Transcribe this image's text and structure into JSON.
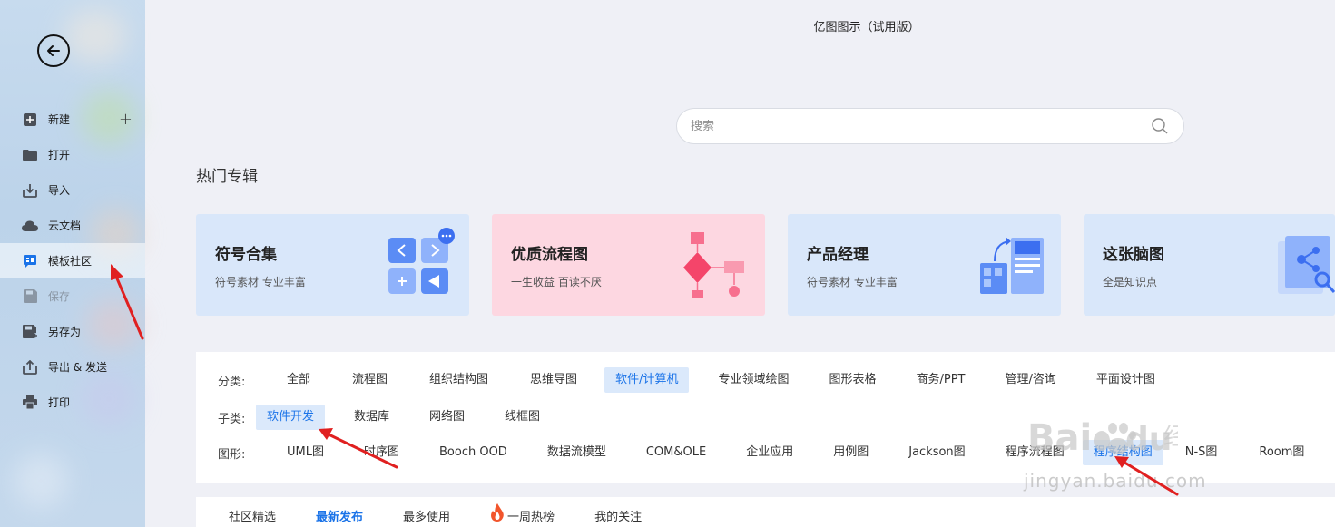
{
  "window": {
    "title": "亿图图示（试用版）"
  },
  "sidebar": {
    "back_icon": "arrow-left-icon",
    "items": [
      {
        "label": "新建",
        "icon": "plus-square-icon",
        "has_plus": true
      },
      {
        "label": "打开",
        "icon": "folder-icon"
      },
      {
        "label": "导入",
        "icon": "import-icon"
      },
      {
        "label": "云文档",
        "icon": "cloud-icon"
      },
      {
        "label": "模板社区",
        "icon": "template-community-icon",
        "active": true
      },
      {
        "label": "保存",
        "icon": "save-icon",
        "disabled": true
      },
      {
        "label": "另存为",
        "icon": "save-as-icon"
      },
      {
        "label": "导出 & 发送",
        "icon": "export-icon"
      },
      {
        "label": "打印",
        "icon": "print-icon"
      }
    ],
    "plus_symbol": "+"
  },
  "search": {
    "placeholder": "搜索"
  },
  "section_title": "热门专辑",
  "cards": [
    {
      "title": "符号合集",
      "subtitle": "符号素材 专业丰富",
      "bg": "#d9e7fa"
    },
    {
      "title": "优质流程图",
      "subtitle": "一生收益 百读不厌",
      "bg": "#fdd7e1"
    },
    {
      "title": "产品经理",
      "subtitle": "符号素材 专业丰富",
      "bg": "#d9e7fa"
    },
    {
      "title": "这张脑图",
      "subtitle": "全是知识点",
      "bg": "#d9e7fa"
    }
  ],
  "filter": {
    "category_label": "分类:",
    "categories": [
      "全部",
      "流程图",
      "组织结构图",
      "思维导图",
      "软件/计算机",
      "专业领域绘图",
      "图形表格",
      "商务/PPT",
      "管理/咨询",
      "平面设计图"
    ],
    "category_selected": 4,
    "subcategory_label": "子类:",
    "subcategories": [
      "软件开发",
      "数据库",
      "网络图",
      "线框图"
    ],
    "subcategory_selected": 0,
    "shape_label": "图形:",
    "shapes": [
      "UML图",
      "时序图",
      "Booch OOD",
      "数据流模型",
      "COM&OLE",
      "企业应用",
      "用例图",
      "Jackson图",
      "程序流程图",
      "程序结构图",
      "N-S图",
      "Room图"
    ],
    "shape_selected": 9
  },
  "tabs": [
    "社区精选",
    "最新发布",
    "最多使用",
    "一周热榜",
    "我的关注"
  ],
  "tab_active": 1,
  "watermark": {
    "text": "jingyan.baidu.com",
    "logo": "Baidu经验"
  },
  "colors": {
    "accent": "#1a73e8",
    "annotation": "#e02020"
  }
}
